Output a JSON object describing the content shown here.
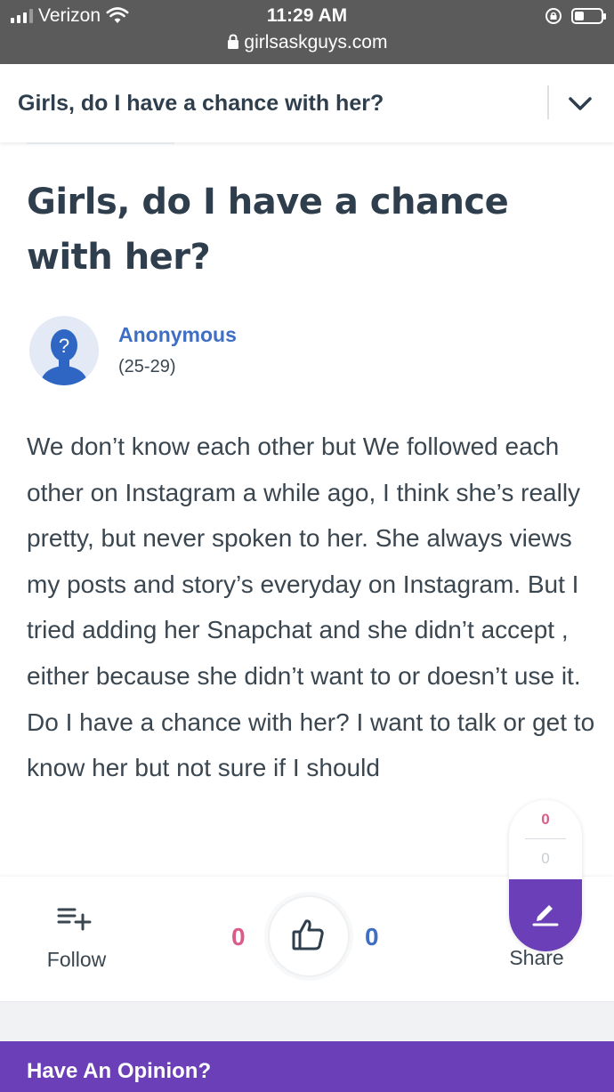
{
  "status_bar": {
    "carrier": "Verizon",
    "time": "11:29 AM",
    "url": "girlsaskguys.com",
    "icons": [
      "signal-icon",
      "wifi-icon",
      "rotation-lock-icon",
      "battery-icon",
      "lock-icon"
    ]
  },
  "header": {
    "title": "Girls, do I have a chance with her?",
    "expand_icon": "chevron-down-icon"
  },
  "question": {
    "title": "Girls, do I have a chance with her?",
    "author": {
      "name": "Anonymous",
      "age": "(25-29)"
    },
    "body": "We don’t know each other but We followed each other on Instagram a while ago, I think she’s really pretty, but never spoken to her. She always views my posts and story’s everyday on Instagram. But I tried adding her Snapchat and she didn’t accept , either because she didn’t want to or doesn’t use it. Do I have a chance with her? I want to talk or get to know her but not sure if I should"
  },
  "actions": {
    "follow_label": "Follow",
    "vote_count_left": "0",
    "vote_count_right": "0",
    "share_label": "Share"
  },
  "opinion_pill": {
    "count_top": "0",
    "count_bottom": "0"
  },
  "footer": {
    "opinion_label": "Have An Opinion?"
  },
  "colors": {
    "accent_purple": "#6a3fb7",
    "link_blue": "#3f6fc4",
    "pink": "#d95c8a"
  }
}
